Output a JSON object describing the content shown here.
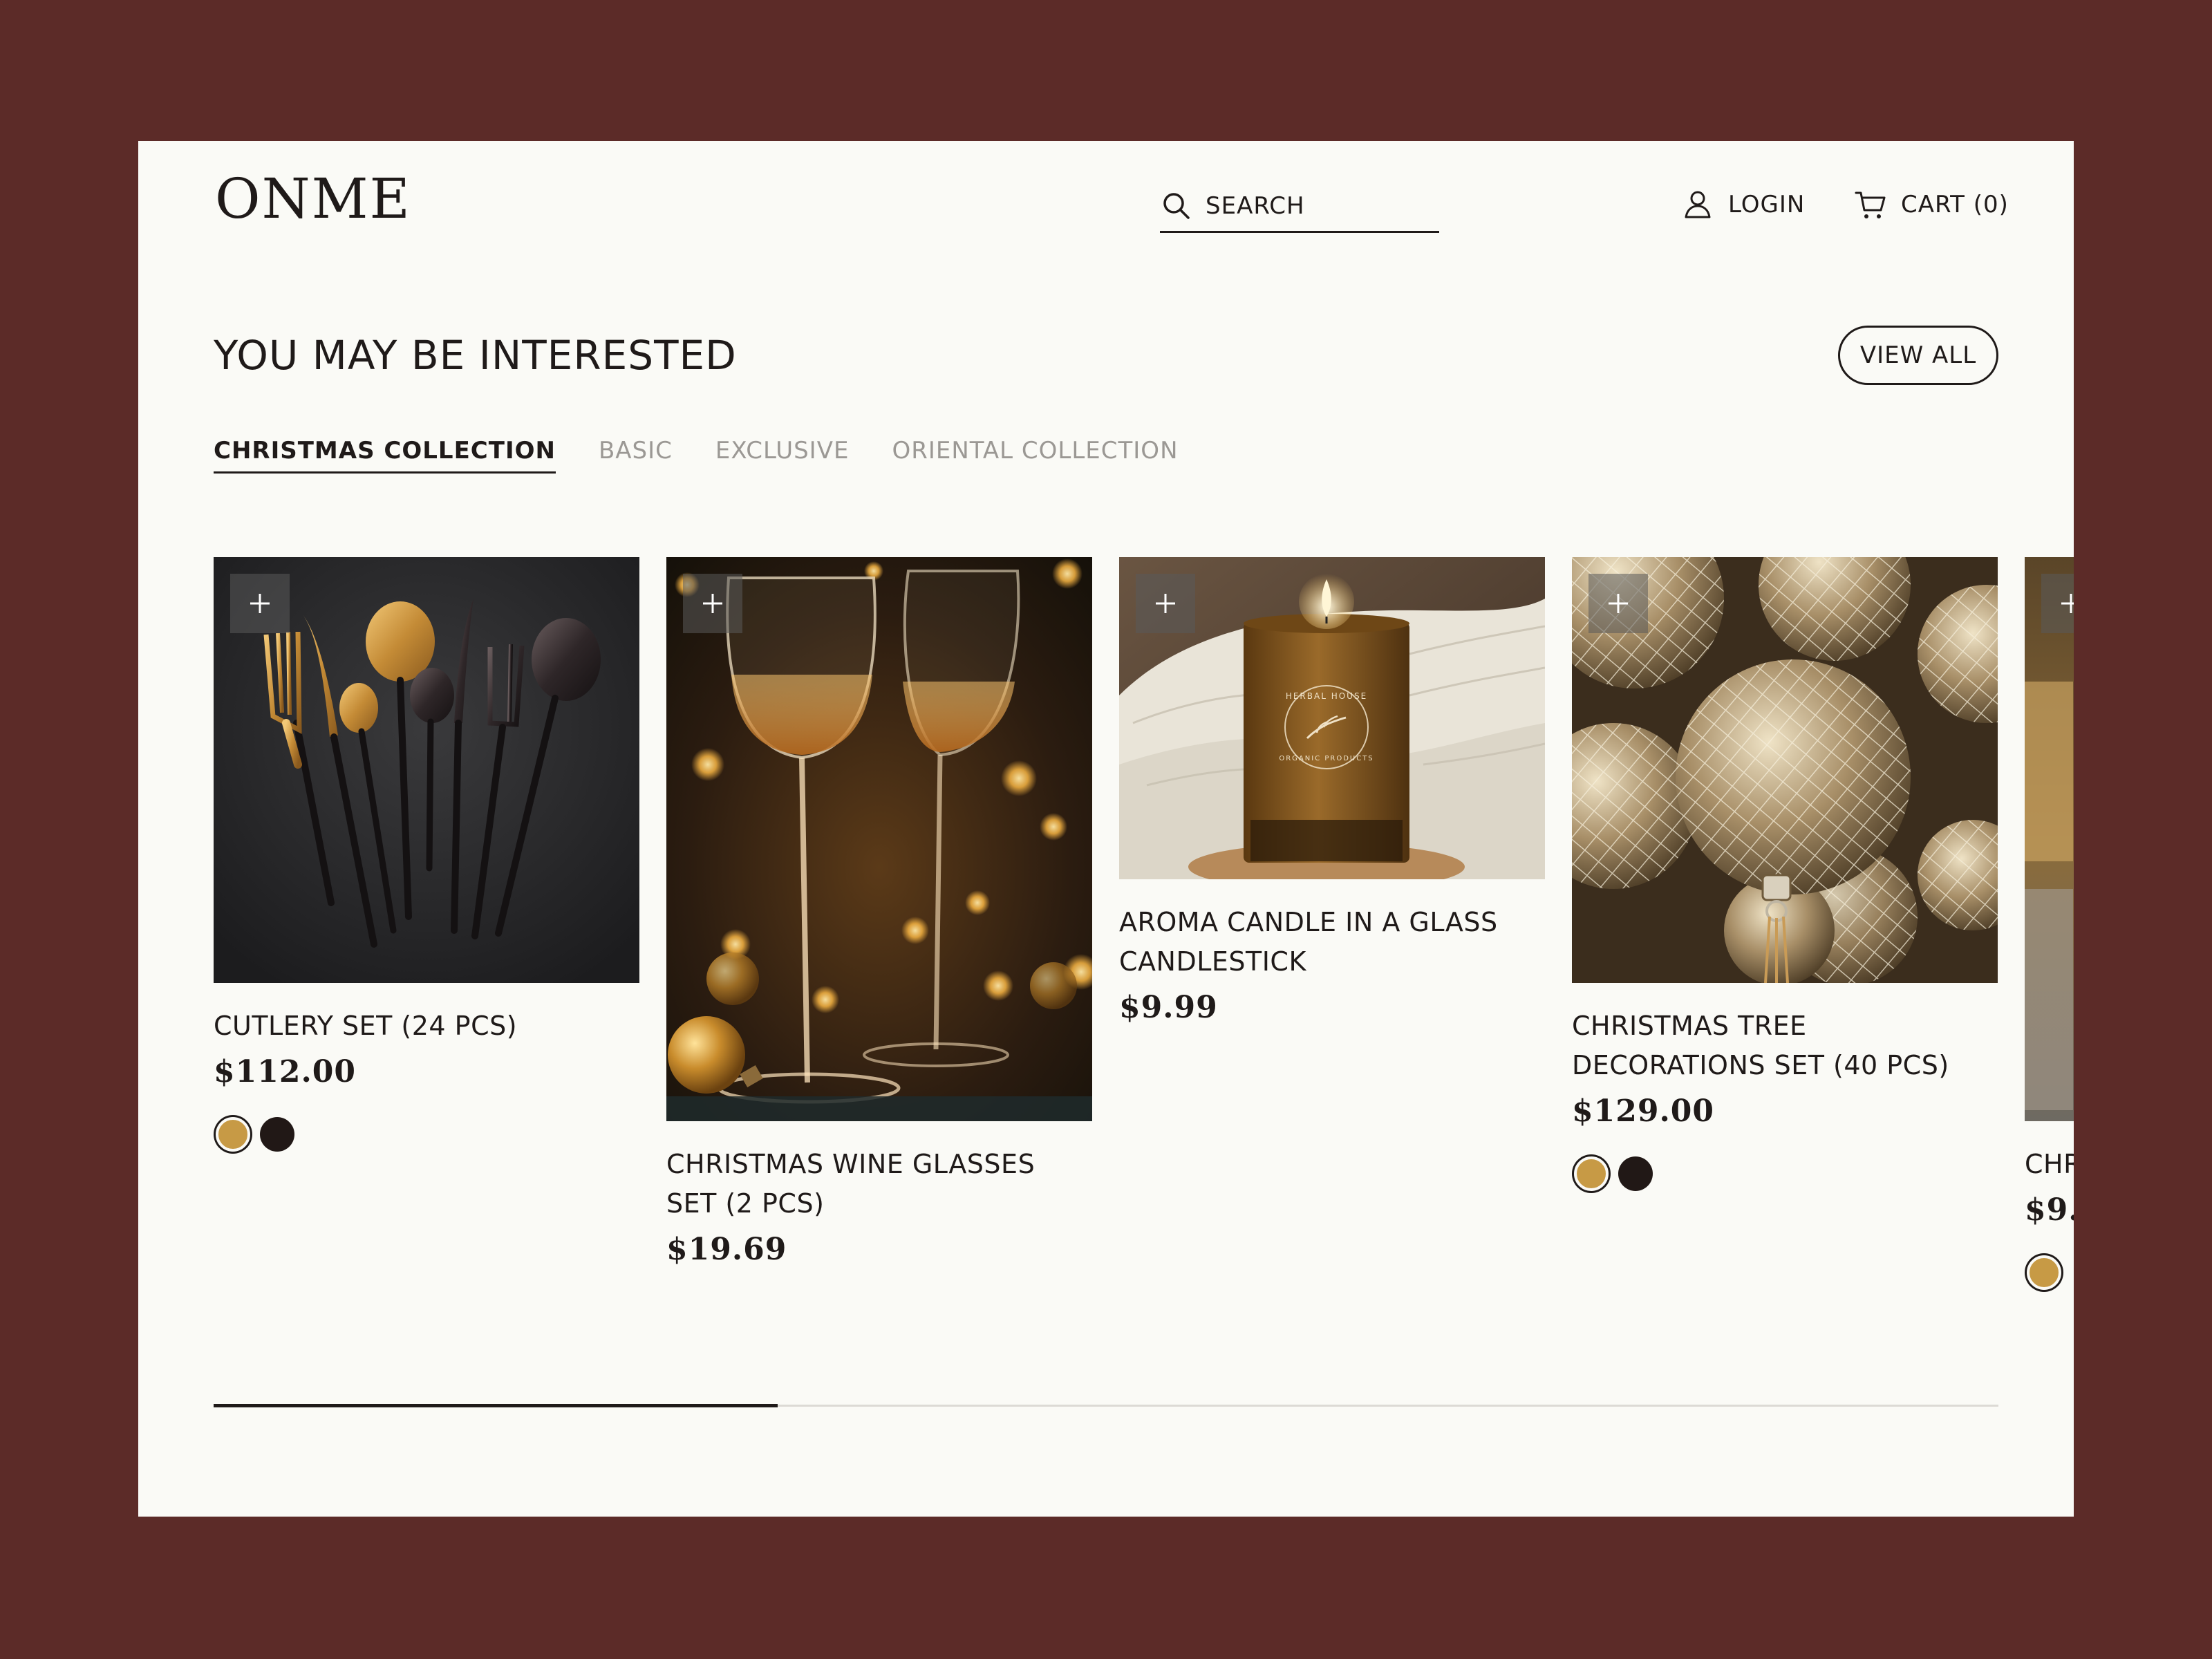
{
  "header": {
    "logo": "ONME",
    "search_placeholder": "SEARCH",
    "login_label": "LOGIN",
    "cart_label": "CART (0)"
  },
  "section": {
    "title": "YOU MAY BE INTERESTED",
    "view_all_label": "VIEW ALL",
    "tabs": [
      {
        "label": "CHRISTMAS COLLECTION",
        "active": true
      },
      {
        "label": "BASIC",
        "active": false
      },
      {
        "label": "EXCLUSIVE",
        "active": false
      },
      {
        "label": "ORIENTAL COLLECTION",
        "active": false
      }
    ]
  },
  "products": [
    {
      "name": "CUTLERY SET (24 PCS)",
      "price": "$112.00",
      "swatches": [
        "gold",
        "black"
      ]
    },
    {
      "name": "CHRISTMAS WINE GLASSES SET (2 PCS)",
      "price": "$19.69",
      "swatches": []
    },
    {
      "name": "AROMA CANDLE IN A GLASS CANDLESTICK",
      "price": "$9.99",
      "swatches": []
    },
    {
      "name": "CHRISTMAS TREE DECORATIONS SET (40 PCS)",
      "price": "$129.00",
      "swatches": [
        "gold",
        "black"
      ]
    },
    {
      "name": "CHR",
      "price": "$9.",
      "swatches": [
        "gold"
      ]
    }
  ],
  "candle_label": {
    "line1": "HERBAL HOUSE",
    "line2": "ORGANIC PRODUCTS"
  },
  "carousel_progress": 0.316,
  "colors": {
    "page_background": "#5c2b28",
    "panel_background": "#fafaf6",
    "swatch_gold": "#c79a45",
    "swatch_black": "#211816"
  }
}
